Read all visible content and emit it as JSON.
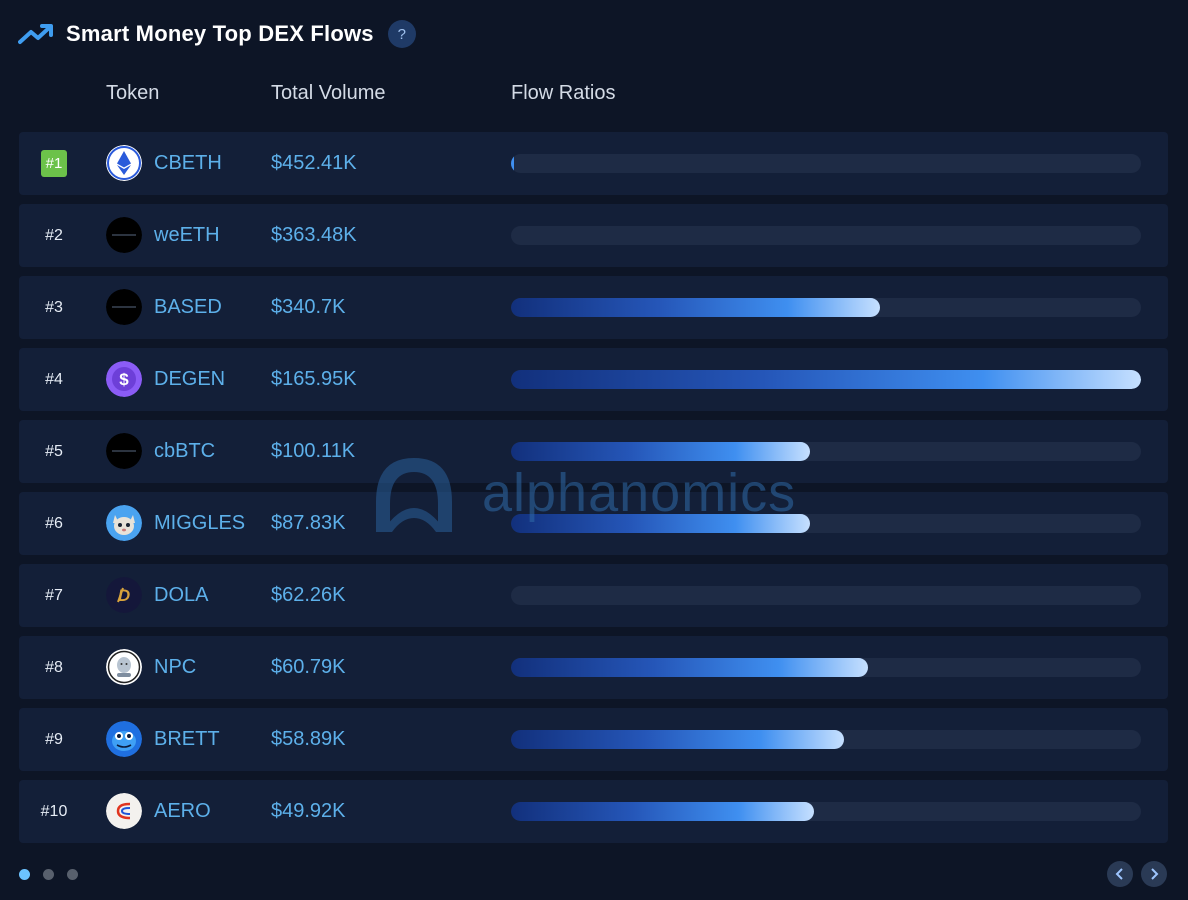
{
  "header": {
    "title": "Smart Money Top DEX Flows",
    "help_label": "?"
  },
  "columns": {
    "token": "Token",
    "volume": "Total Volume",
    "flow": "Flow Ratios"
  },
  "rows": [
    {
      "rank": "#1",
      "token": "CBETH",
      "volume": "$452.41K",
      "flow_ratio": 0.004,
      "icon": "ethereum-icon"
    },
    {
      "rank": "#2",
      "token": "weETH",
      "volume": "$363.48K",
      "flow_ratio": 0.0,
      "icon": "dark-token-icon"
    },
    {
      "rank": "#3",
      "token": "BASED",
      "volume": "$340.7K",
      "flow_ratio": 0.585,
      "icon": "dark-token-icon"
    },
    {
      "rank": "#4",
      "token": "DEGEN",
      "volume": "$165.95K",
      "flow_ratio": 1.0,
      "icon": "dollar-coin-icon"
    },
    {
      "rank": "#5",
      "token": "cbBTC",
      "volume": "$100.11K",
      "flow_ratio": 0.475,
      "icon": "dark-token-icon"
    },
    {
      "rank": "#6",
      "token": "MIGGLES",
      "volume": "$87.83K",
      "flow_ratio": 0.475,
      "icon": "cat-icon"
    },
    {
      "rank": "#7",
      "token": "DOLA",
      "volume": "$62.26K",
      "flow_ratio": 0.0,
      "icon": "dola-icon"
    },
    {
      "rank": "#8",
      "token": "NPC",
      "volume": "$60.79K",
      "flow_ratio": 0.567,
      "icon": "npc-face-icon"
    },
    {
      "rank": "#9",
      "token": "BRETT",
      "volume": "$58.89K",
      "flow_ratio": 0.529,
      "icon": "brett-icon"
    },
    {
      "rank": "#10",
      "token": "AERO",
      "volume": "$49.92K",
      "flow_ratio": 0.481,
      "icon": "aero-icon"
    }
  ],
  "watermark": "alphanomics",
  "pager": {
    "pages": 3,
    "active": 0
  },
  "colors": {
    "accent": "#5db0ea",
    "badge": "#6cc24a",
    "background": "#0d1526",
    "row": "#131f38"
  }
}
